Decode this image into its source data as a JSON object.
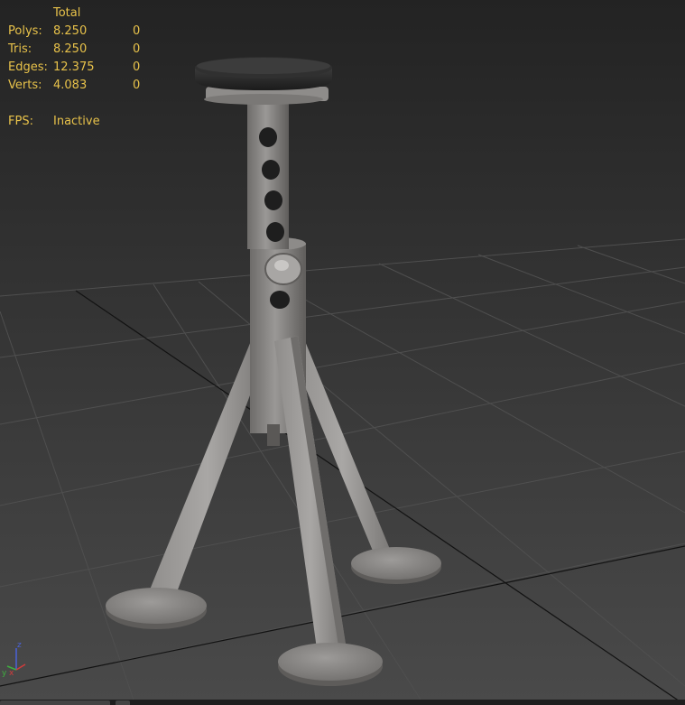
{
  "viewport": {
    "colors": {
      "background_top": "#232323",
      "background_bottom": "#4a4a4a",
      "grid_line": "#4f4f4f",
      "grid_axis": "#101010",
      "stats_text": "#e8c24a",
      "model_gray": "#8c8a88",
      "model_dark": "#6d6b69",
      "seat_black": "#262626"
    },
    "stats": {
      "header": "Total",
      "rows": [
        {
          "label": "Polys:",
          "total": "8.250",
          "selected": "0"
        },
        {
          "label": "Tris:",
          "total": "8.250",
          "selected": "0"
        },
        {
          "label": "Edges:",
          "total": "12.375",
          "selected": "0"
        },
        {
          "label": "Verts:",
          "total": "4.083",
          "selected": "0"
        }
      ],
      "fps_label": "FPS:",
      "fps_value": "Inactive"
    },
    "gizmo": {
      "x_label": "x",
      "y_label": "y",
      "z_label": "z",
      "x_color": "#d23b3b",
      "y_color": "#3fae3f",
      "z_color": "#4a62d8"
    }
  }
}
